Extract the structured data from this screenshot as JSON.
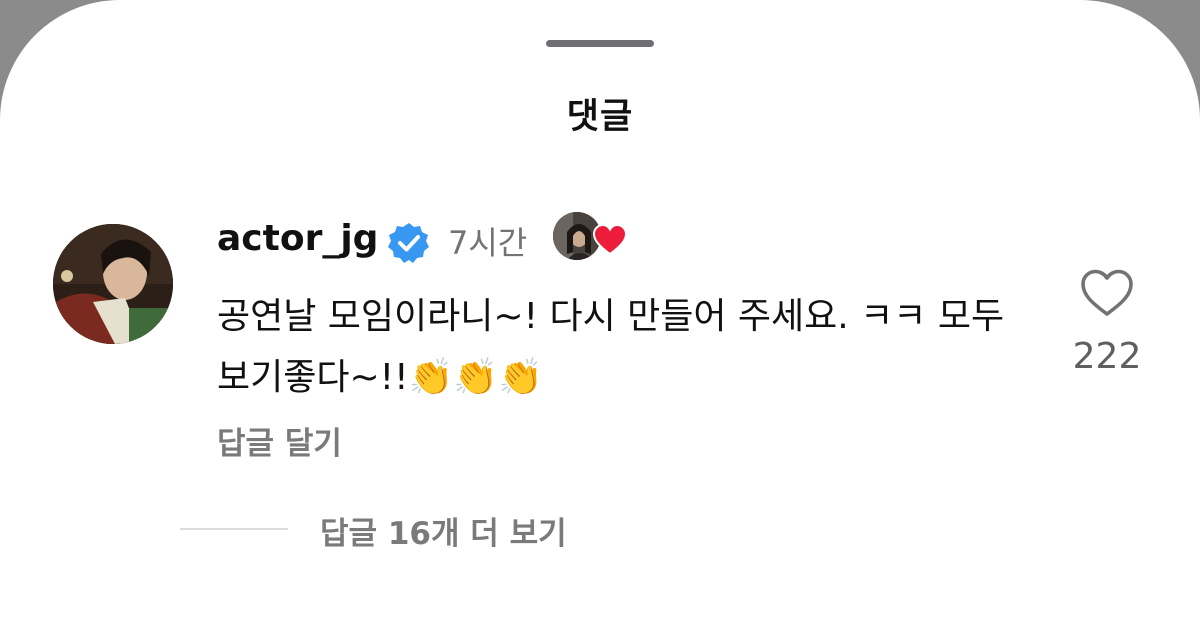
{
  "sheet": {
    "title": "댓글"
  },
  "comment": {
    "username": "actor_jg",
    "verified_icon": "verified-badge-icon",
    "timestamp": "7시간",
    "text_main": "공연날 모임이라니~! 다시 만들어 주세요. ㅋㅋ  모두 보기좋다~!!",
    "emojis": "👏👏👏",
    "reply_label": "답글 달기",
    "like_icon": "heart-outline-icon",
    "like_count": "222",
    "creator_liked_icon": "red-heart-icon"
  },
  "replies": {
    "view_more_label": "답글 16개 더 보기"
  },
  "colors": {
    "verified": "#3897f0",
    "heart_red": "#ed1c3a",
    "secondary_text": "#737373",
    "sheet_background": "#ffffff"
  }
}
